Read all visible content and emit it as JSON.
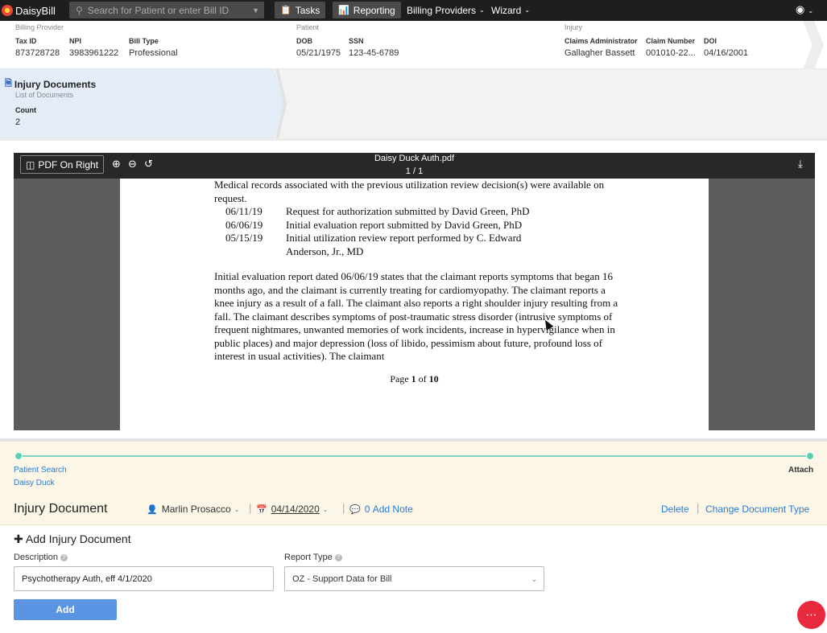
{
  "topnav": {
    "logo": "DaisyBill",
    "search_placeholder": "Search for Patient or enter Bill ID",
    "tasks": "Tasks",
    "reporting": "Reporting",
    "billing_providers": "Billing Providers",
    "wizard": "Wizard"
  },
  "billing_provider": {
    "title": "Billing Provider",
    "tax_id_label": "Tax ID",
    "tax_id": "873728728",
    "npi_label": "NPI",
    "npi": "3983961222",
    "bill_type_label": "Bill Type",
    "bill_type": "Professional"
  },
  "patient": {
    "title": "Patient",
    "dob_label": "DOB",
    "dob": "05/21/1975",
    "ssn_label": "SSN",
    "ssn": "123-45-6789"
  },
  "injury": {
    "title": "Injury",
    "claims_admin_label": "Claims Administrator",
    "claims_admin": "Gallagher Bassett",
    "claim_number_label": "Claim Number",
    "claim_number": "001010-22...",
    "doi_label": "DOI",
    "doi": "04/16/2001"
  },
  "injury_documents": {
    "title": "Injury Documents",
    "subtitle": "List of Documents",
    "count_label": "Count",
    "count": "2"
  },
  "viewer": {
    "pdf_right_label": "PDF On Right",
    "file_name": "Daisy Duck Auth.pdf",
    "pages": "1 / 1",
    "para1": "Medical records associated with the previous utilization review decision(s) were available on request.",
    "list": [
      {
        "date": "06/11/19",
        "text": "Request for authorization submitted by David Green, PhD"
      },
      {
        "date": "06/06/19",
        "text": "Initial evaluation report submitted by David Green, PhD"
      },
      {
        "date": "05/15/19",
        "text": "Initial utilization review report performed by C. Edward"
      },
      {
        "date": "",
        "text": "Anderson, Jr., MD"
      }
    ],
    "para2": "Initial evaluation report dated 06/06/19 states that the claimant reports symptoms that began 16 months ago, and the claimant is currently treating for cardiomyopathy.  The claimant reports a knee injury as a result of a fall.  The claimant also reports a right shoulder injury resulting from a fall.  The claimant describes symptoms of post-traumatic stress disorder (intrusive symptoms of frequent nightmares, unwanted memories of work incidents, increase in hypervigilance when in public places) and major depression (loss of libido, pessimism about future, profound loss of interest in usual activities).  The claimant",
    "page_prefix": "Page ",
    "page_num": "1",
    "page_of": " of ",
    "page_total": "10"
  },
  "progress": {
    "step1_label": "Patient Search",
    "step1_value": "Daisy Duck",
    "step2_label": "Attach",
    "complete_fraction": 1.0
  },
  "doc_header": {
    "title": "Injury Document",
    "user": "Marlin Prosacco",
    "date": "04/14/2020",
    "notes_count": "0",
    "add_note": "Add Note",
    "delete": "Delete",
    "change_type": "Change Document Type"
  },
  "form": {
    "title": "Add Injury Document",
    "description_label": "Description",
    "description_value": "Psychotherapy Auth, eff 4/1/2020",
    "report_type_label": "Report Type",
    "report_type_value": "OZ - Support Data for Bill",
    "add_button": "Add"
  },
  "colors": {
    "nav_bg": "#1e1e1e",
    "accent_blue": "#2b7bd0",
    "button_blue": "#5b94e3",
    "progress_green": "#5ccfb0",
    "chat_red": "#e8283c"
  }
}
